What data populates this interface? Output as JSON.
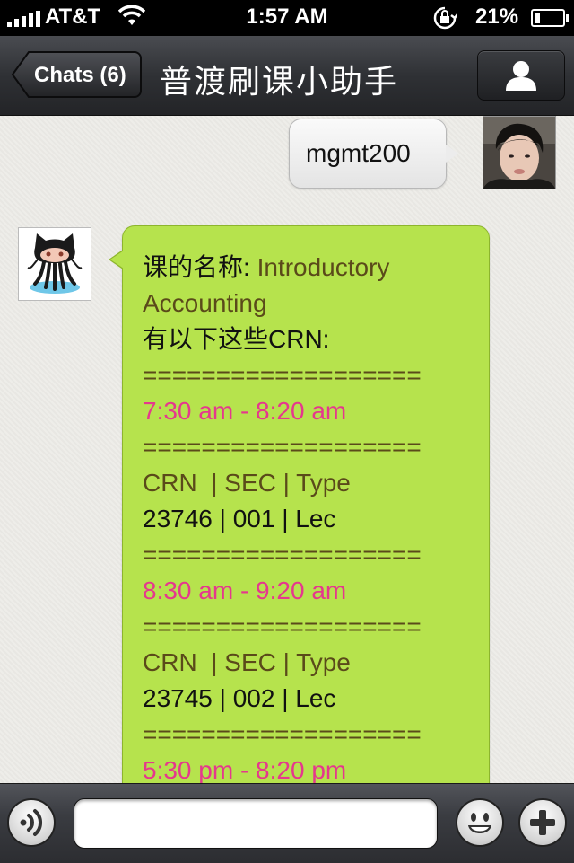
{
  "status_bar": {
    "carrier": "AT&T",
    "time": "1:57 AM",
    "battery_percent": "21%",
    "battery_level": 0.21,
    "icons": [
      "signal-icon",
      "wifi-icon",
      "rotation-lock-icon",
      "battery-icon"
    ]
  },
  "nav": {
    "back_label": "Chats (6)",
    "title": "普渡刷课小助手",
    "profile_icon": "person-icon"
  },
  "messages": {
    "sent": {
      "text": "mgmt200",
      "avatar": "user-photo-avatar"
    },
    "received": {
      "avatar": "octocat-avatar",
      "lines": [
        {
          "parts": [
            {
              "text": "课的名称: ",
              "color": "#111111"
            },
            {
              "text": "Introductory",
              "color": "#5a4a1a"
            }
          ]
        },
        {
          "parts": [
            {
              "text": "Accounting",
              "color": "#5a4a1a"
            }
          ]
        },
        {
          "parts": [
            {
              "text": "有以下这些CRN:",
              "color": "#111111"
            }
          ]
        },
        {
          "parts": [
            {
              "text": "===================",
              "color": "#5a4a1a"
            }
          ]
        },
        {
          "parts": [
            {
              "text": "7:30 am - 8:20 am",
              "color": "#e5388d"
            }
          ]
        },
        {
          "parts": [
            {
              "text": "===================",
              "color": "#5a4a1a"
            }
          ]
        },
        {
          "parts": [
            {
              "text": "CRN  | SEC | Type",
              "color": "#5a4a1a"
            }
          ]
        },
        {
          "parts": [
            {
              "text": "23746 | 001 | Lec",
              "color": "#111111"
            }
          ]
        },
        {
          "parts": [
            {
              "text": "===================",
              "color": "#5a4a1a"
            }
          ]
        },
        {
          "parts": [
            {
              "text": "8:30 am - 9:20 am",
              "color": "#e5388d"
            }
          ]
        },
        {
          "parts": [
            {
              "text": "===================",
              "color": "#5a4a1a"
            }
          ]
        },
        {
          "parts": [
            {
              "text": "CRN  | SEC | Type",
              "color": "#5a4a1a"
            }
          ]
        },
        {
          "parts": [
            {
              "text": "23745 | 002 | Lec",
              "color": "#111111"
            }
          ]
        },
        {
          "parts": [
            {
              "text": "===================",
              "color": "#5a4a1a"
            }
          ]
        },
        {
          "parts": [
            {
              "text": "5:30 pm - 8:20 pm",
              "color": "#e5388d"
            }
          ]
        }
      ]
    }
  },
  "input_bar": {
    "value": "",
    "icons": [
      "voice-icon",
      "emoji-icon",
      "plus-icon"
    ]
  },
  "colors": {
    "bubble_received": "#b6e34d",
    "bubble_sent": "#f0f0f0",
    "time_accent": "#e5388d",
    "nav_bar": "#2f3135"
  }
}
